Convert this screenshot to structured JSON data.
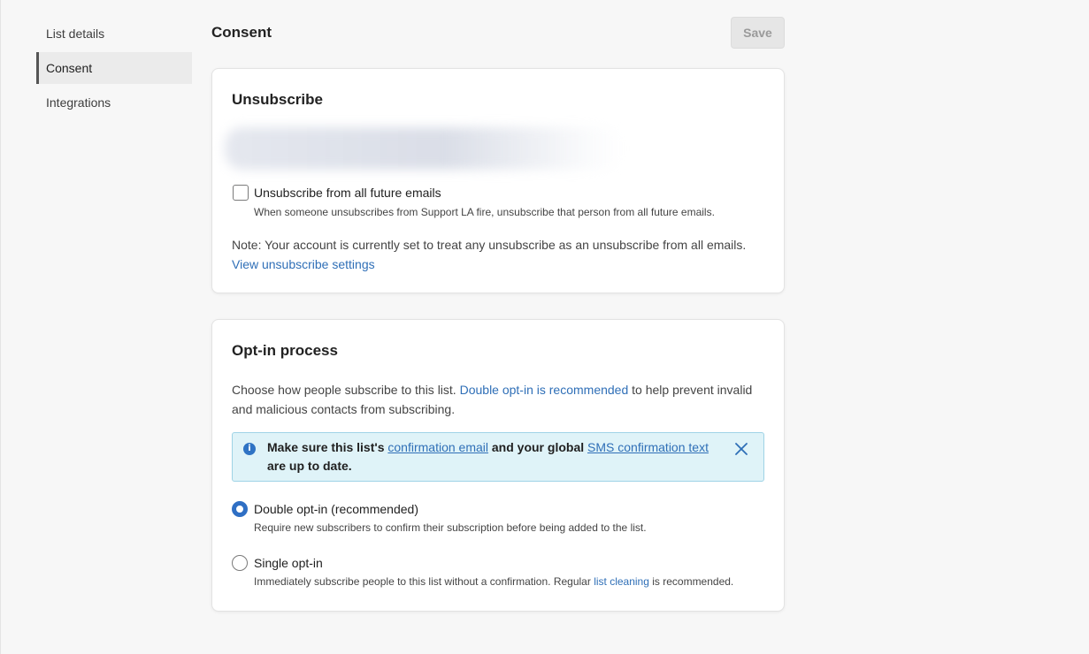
{
  "sidebar": {
    "items": [
      {
        "label": "List details"
      },
      {
        "label": "Consent"
      },
      {
        "label": "Integrations"
      }
    ]
  },
  "header": {
    "title": "Consent",
    "save_label": "Save"
  },
  "unsubscribe": {
    "title": "Unsubscribe",
    "checkbox_label": "Unsubscribe from all future emails",
    "checkbox_help": "When someone unsubscribes from Support LA fire, unsubscribe that person from all future emails.",
    "checked": false,
    "note": "Note: Your account is currently set to treat any unsubscribe as an unsubscribe from all emails.",
    "settings_link": "View unsubscribe settings"
  },
  "optin": {
    "title": "Opt-in process",
    "desc_before": "Choose how people subscribe to this list. ",
    "desc_link": "Double opt-in is recommended",
    "desc_after": " to help prevent invalid and malicious contacts from subscribing.",
    "info": {
      "part1": "Make sure this list's ",
      "link1": "confirmation email",
      "part2": " and your global ",
      "link2": "SMS confirmation text",
      "part3": " are up to date."
    },
    "options": [
      {
        "label": "Double opt-in (recommended)",
        "help": "Require new subscribers to confirm their subscription before being added to the list.",
        "selected": true
      },
      {
        "label": "Single opt-in",
        "help_before": "Immediately subscribe people to this list without a confirmation. Regular ",
        "help_link": "list cleaning",
        "help_after": " is recommended.",
        "selected": false
      }
    ]
  },
  "colors": {
    "accent": "#2f6fc4",
    "link": "#2f6fb7",
    "info_bg": "#dff3f8"
  }
}
